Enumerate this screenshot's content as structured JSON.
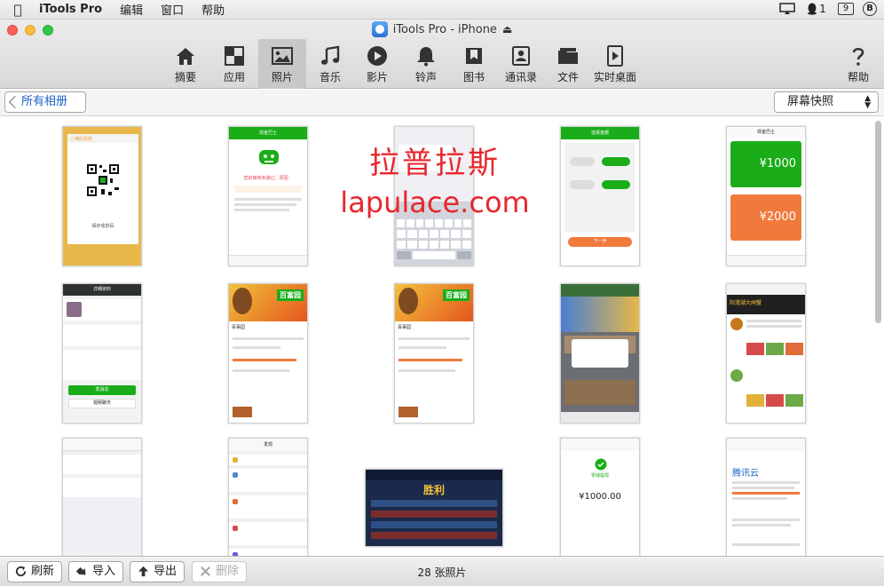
{
  "menubar": {
    "app_name": "iTools Pro",
    "menus": [
      "编辑",
      "窗口",
      "帮助"
    ],
    "notification_count": "1",
    "calendar_day": "9",
    "account_initial": "B"
  },
  "window": {
    "title": "iTools Pro - iPhone"
  },
  "toolbar": {
    "items": [
      {
        "label": "摘要",
        "icon": "home-icon"
      },
      {
        "label": "应用",
        "icon": "apps-grid-icon"
      },
      {
        "label": "照片",
        "icon": "photo-icon"
      },
      {
        "label": "音乐",
        "icon": "music-note-icon"
      },
      {
        "label": "影片",
        "icon": "play-icon"
      },
      {
        "label": "铃声",
        "icon": "bell-icon"
      },
      {
        "label": "图书",
        "icon": "book-icon"
      },
      {
        "label": "通讯录",
        "icon": "contacts-icon"
      },
      {
        "label": "文件",
        "icon": "folder-icon"
      },
      {
        "label": "实时桌面",
        "icon": "screen-play-icon"
      }
    ],
    "active": "照片",
    "help_label": "帮助"
  },
  "subbar": {
    "back_label": "所有相册",
    "select_value": "屏幕快照"
  },
  "watermark": {
    "line1": "拉普拉斯",
    "line2": "lapulace.com"
  },
  "bottom": {
    "refresh_label": "刷新",
    "import_label": "导入",
    "export_label": "导出",
    "delete_label": "删除",
    "photo_count": "28 张照片"
  },
  "thumbs": {
    "t1": {
      "title": "二维码收款",
      "caption": "保存收款码"
    },
    "t2": {
      "title": "现金巴士",
      "caption": "您的审核未通过，原因："
    },
    "t4": {
      "title": "选择金额",
      "button": "下一步"
    },
    "t5": {
      "title": "现金巴士",
      "amount1": "¥1000",
      "amount2": "¥2000"
    },
    "t6": {
      "title": "详细资料",
      "button1": "发消息",
      "button2": "视频聊天"
    },
    "t7": {
      "title": "百事园",
      "brand": "百富园"
    },
    "t8": {
      "title": "百事园",
      "brand": "百富园"
    },
    "t10": {
      "title": "阳澄湖大闸蟹"
    },
    "t12": {
      "title": "发现"
    },
    "t13": {
      "label": "胜利"
    },
    "t14": {
      "amount": "¥1000.00",
      "caption": "零钱提现"
    },
    "t15": {
      "brand": "腾讯云"
    }
  },
  "colors": {
    "wechat_green": "#1aad19",
    "yellow_bg": "#e8b94a",
    "orange": "#f07a3c",
    "accent_blue": "#1a63c8"
  }
}
